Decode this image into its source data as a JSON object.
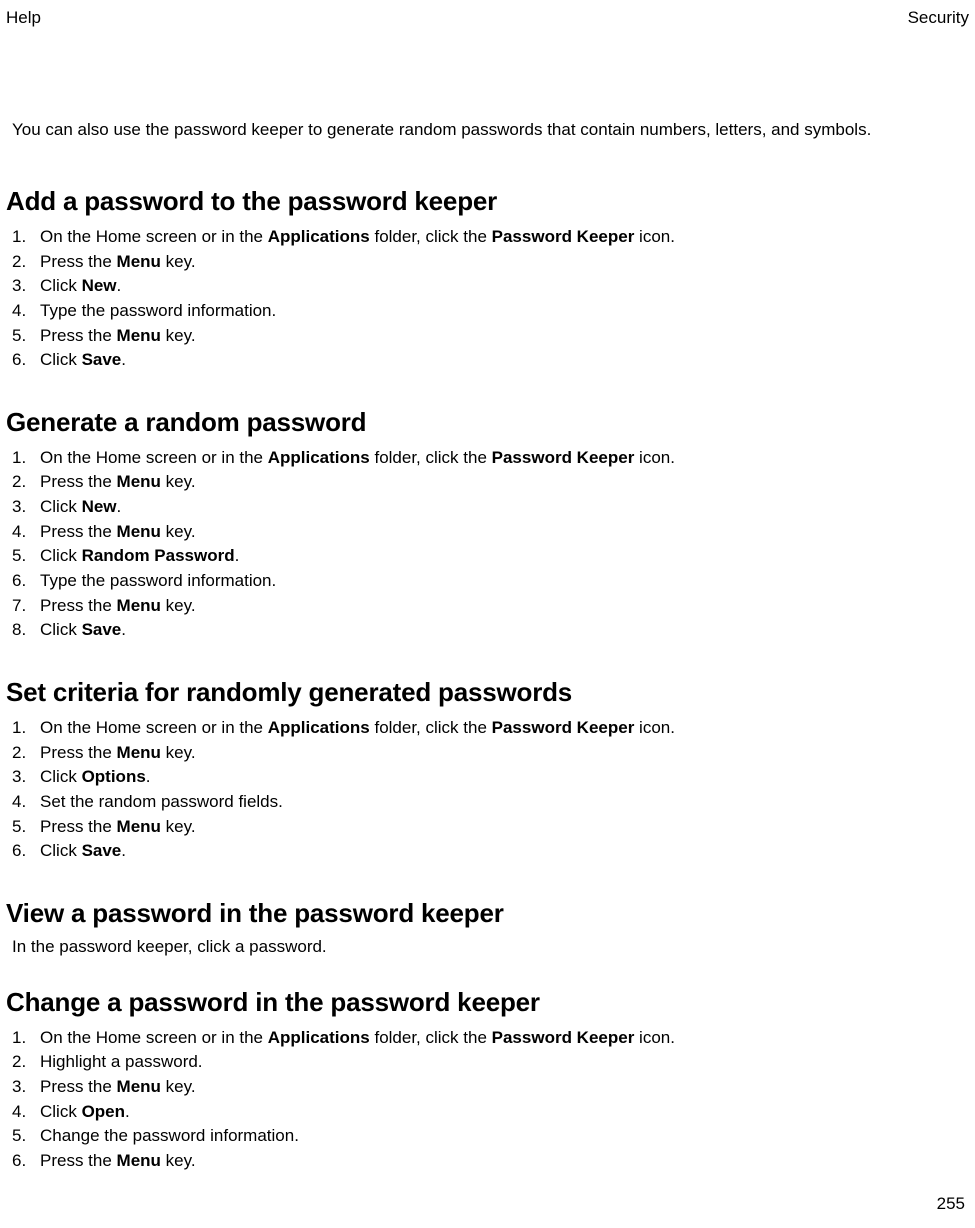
{
  "header": {
    "left": "Help",
    "right": "Security"
  },
  "intro": "You can also use the password keeper to generate random passwords that contain numbers, letters, and symbols.",
  "sections": [
    {
      "title": "Add a password to the password keeper",
      "type": "ol",
      "items": [
        [
          {
            "t": "On the Home screen or in the "
          },
          {
            "b": "Applications"
          },
          {
            "t": " folder, click the "
          },
          {
            "b": "Password Keeper"
          },
          {
            "t": " icon."
          }
        ],
        [
          {
            "t": "Press the "
          },
          {
            "b": "Menu"
          },
          {
            "t": " key."
          }
        ],
        [
          {
            "t": "Click "
          },
          {
            "b": "New"
          },
          {
            "t": "."
          }
        ],
        [
          {
            "t": "Type the password information."
          }
        ],
        [
          {
            "t": "Press the "
          },
          {
            "b": "Menu"
          },
          {
            "t": " key."
          }
        ],
        [
          {
            "t": "Click "
          },
          {
            "b": "Save"
          },
          {
            "t": "."
          }
        ]
      ]
    },
    {
      "title": "Generate a random password",
      "type": "ol",
      "items": [
        [
          {
            "t": "On the Home screen or in the "
          },
          {
            "b": "Applications"
          },
          {
            "t": " folder, click the "
          },
          {
            "b": "Password Keeper"
          },
          {
            "t": " icon."
          }
        ],
        [
          {
            "t": "Press the "
          },
          {
            "b": "Menu"
          },
          {
            "t": " key."
          }
        ],
        [
          {
            "t": "Click "
          },
          {
            "b": "New"
          },
          {
            "t": "."
          }
        ],
        [
          {
            "t": "Press the "
          },
          {
            "b": "Menu"
          },
          {
            "t": " key."
          }
        ],
        [
          {
            "t": "Click "
          },
          {
            "b": "Random Password"
          },
          {
            "t": "."
          }
        ],
        [
          {
            "t": "Type the password information."
          }
        ],
        [
          {
            "t": "Press the "
          },
          {
            "b": "Menu"
          },
          {
            "t": " key."
          }
        ],
        [
          {
            "t": "Click "
          },
          {
            "b": "Save"
          },
          {
            "t": "."
          }
        ]
      ]
    },
    {
      "title": "Set criteria for randomly generated passwords",
      "type": "ol",
      "items": [
        [
          {
            "t": "On the Home screen or in the "
          },
          {
            "b": "Applications"
          },
          {
            "t": " folder, click the "
          },
          {
            "b": "Password Keeper"
          },
          {
            "t": " icon."
          }
        ],
        [
          {
            "t": "Press the "
          },
          {
            "b": "Menu"
          },
          {
            "t": " key."
          }
        ],
        [
          {
            "t": "Click "
          },
          {
            "b": "Options"
          },
          {
            "t": "."
          }
        ],
        [
          {
            "t": "Set the random password fields."
          }
        ],
        [
          {
            "t": "Press the "
          },
          {
            "b": "Menu"
          },
          {
            "t": " key."
          }
        ],
        [
          {
            "t": "Click "
          },
          {
            "b": "Save"
          },
          {
            "t": "."
          }
        ]
      ]
    },
    {
      "title": "View a password in the password keeper",
      "type": "para",
      "para": "In the password keeper, click a password."
    },
    {
      "title": "Change a password in the password keeper",
      "type": "ol",
      "items": [
        [
          {
            "t": "On the Home screen or in the "
          },
          {
            "b": "Applications"
          },
          {
            "t": " folder, click the "
          },
          {
            "b": "Password Keeper"
          },
          {
            "t": " icon."
          }
        ],
        [
          {
            "t": "Highlight a password."
          }
        ],
        [
          {
            "t": "Press the "
          },
          {
            "b": "Menu"
          },
          {
            "t": " key."
          }
        ],
        [
          {
            "t": "Click "
          },
          {
            "b": "Open"
          },
          {
            "t": "."
          }
        ],
        [
          {
            "t": "Change the password information."
          }
        ],
        [
          {
            "t": "Press the "
          },
          {
            "b": "Menu"
          },
          {
            "t": " key."
          }
        ]
      ]
    }
  ],
  "page_number": "255"
}
